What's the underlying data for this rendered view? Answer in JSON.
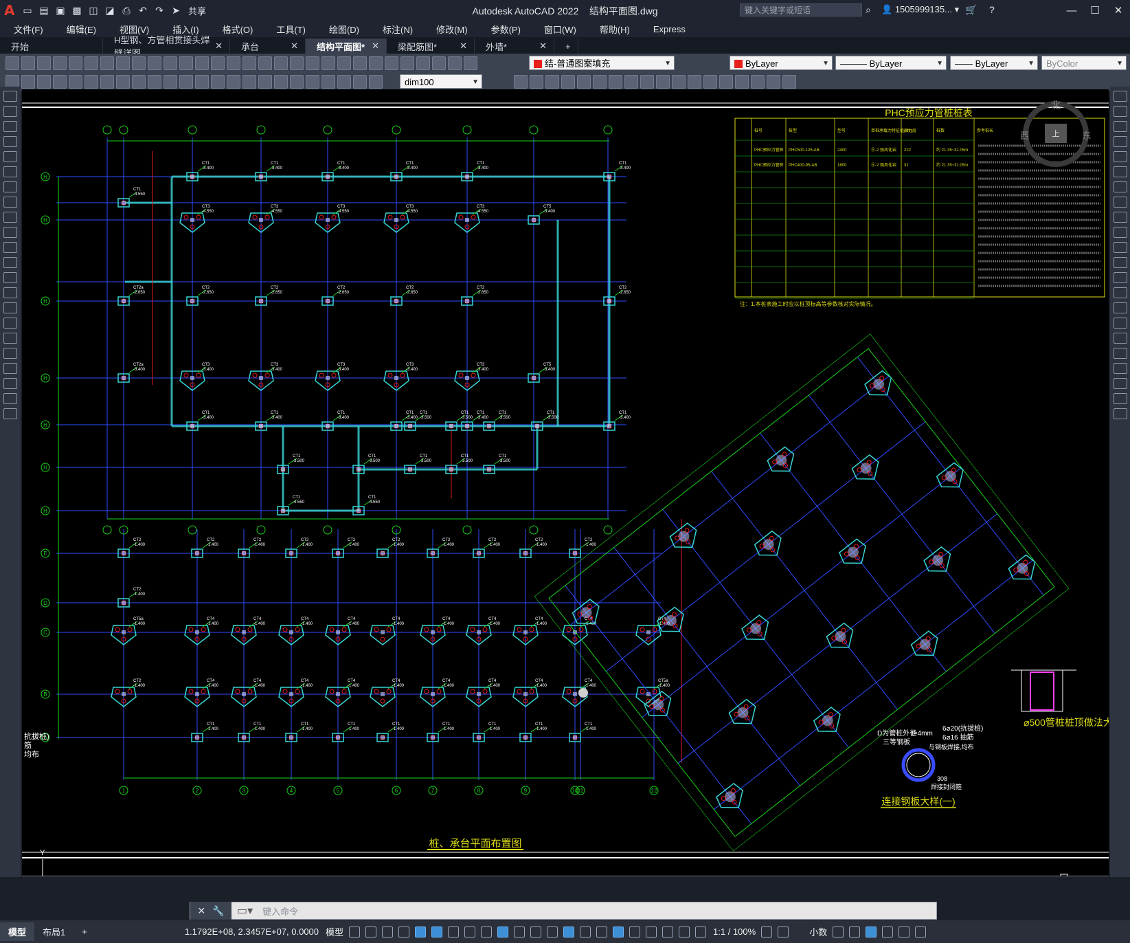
{
  "app": {
    "title": "Autodesk AutoCAD 2022",
    "document": "结构平面图.dwg",
    "share_label": "共享",
    "search_placeholder": "键入关键字或短语",
    "user": "1505999135...",
    "logo": "A"
  },
  "menu": [
    "文件(F)",
    "编辑(E)",
    "视图(V)",
    "插入(I)",
    "格式(O)",
    "工具(T)",
    "绘图(D)",
    "标注(N)",
    "修改(M)",
    "参数(P)",
    "窗口(W)",
    "帮助(H)",
    "Express"
  ],
  "tabs": [
    {
      "label": "开始",
      "active": false
    },
    {
      "label": "H型钢、方管相贯接头焊缝详图",
      "active": false
    },
    {
      "label": "承台",
      "active": false
    },
    {
      "label": "结构平面图*",
      "active": true
    },
    {
      "label": "梁配筋图*",
      "active": false
    },
    {
      "label": "外墙*",
      "active": false
    }
  ],
  "properties": {
    "layer": "结-普通图案填充",
    "color": "ByLayer",
    "linetype": "ByLayer",
    "lineweight": "ByLayer",
    "plotstyle": "ByColor",
    "dimstyle": "dim100",
    "layer_color": "#e8201a"
  },
  "drawing": {
    "pile_table_title": "PHC预应力管桩桩表",
    "pile_table_headers": [
      "桩号",
      "桩型",
      "型号",
      "单桩承载力特征值(kN)",
      "持力层",
      "桩数",
      "参考桩长"
    ],
    "pile_rows": [
      [
        "PHC预应力管桩",
        "PHC500-125-AB",
        "2400",
        "⑤-2 强风化岩",
        "222",
        "约 21.35~31.05m"
      ],
      [
        "PHC预应力管桩",
        "PHC400-95-AB",
        "1600",
        "⑤-2 强风化岩",
        "31",
        "约 21.35~31.05m"
      ]
    ],
    "table_note": "注：1.本桩表施工时应以桩顶标高等参数核对实际情况。",
    "plan_title": "桩、承台平面布置图",
    "detail1_title": "连接钢板大样(一)",
    "detail1_labels": [
      "D为管桩外径",
      "t=4mm",
      "三等钢板",
      "6⌀20(抗拔桩)",
      "6⌀16 抽筋",
      "与钢板焊接,均布",
      "308",
      "焊接封闭箍"
    ],
    "detail2_title": "⌀500管桩桩顶做法大样",
    "compass": [
      "北",
      "西",
      "东",
      "上"
    ],
    "left_note": [
      "抗拔桩)",
      "筋",
      "均布"
    ],
    "axis_rows": [
      "H",
      "G",
      "F",
      "E",
      "D",
      "C",
      "B",
      "A"
    ],
    "axis_cols": [
      "1",
      "2",
      "3",
      "4",
      "5",
      "6",
      "7",
      "8",
      "9",
      "10",
      "11",
      "12"
    ],
    "cap_labels": [
      "CT1",
      "CT2",
      "CT3",
      "CT4",
      "CT5",
      "CT5a",
      "CT2a"
    ],
    "elevations": [
      "-3.400",
      "-1.400",
      "-4.550",
      "-2.650",
      "-3.500"
    ]
  },
  "command": {
    "placeholder": "键入命令"
  },
  "status": {
    "layouts": [
      "模型",
      "布局1"
    ],
    "coords": "1.1792E+08, 2.3457E+07, 0.0000",
    "space": "模型",
    "scale": "1:1 / 100%",
    "units": "小数"
  }
}
